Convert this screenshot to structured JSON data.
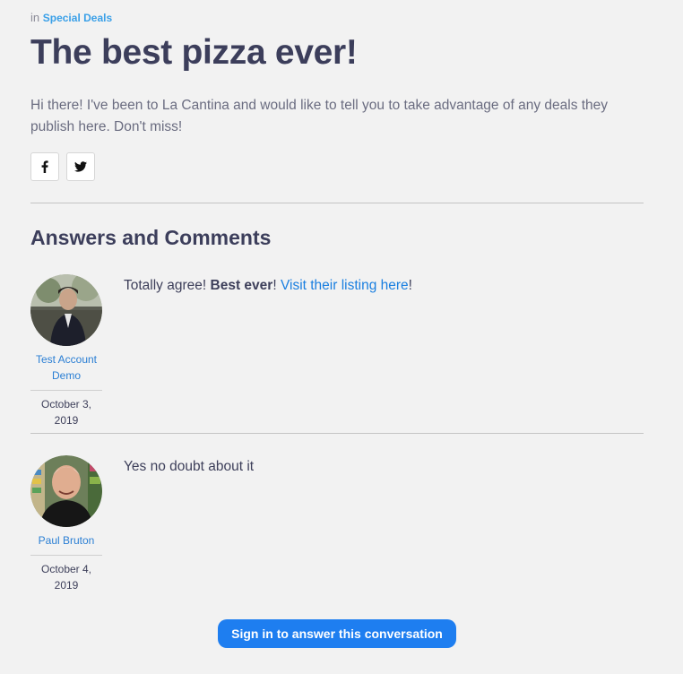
{
  "breadcrumb": {
    "prefix": "in",
    "category": "Special Deals"
  },
  "post": {
    "title": "The best pizza ever!",
    "body": "Hi there! I've been to La Cantina and would like to tell you to take advantage of any deals they publish here. Don't miss!"
  },
  "share": {
    "facebook_icon": "facebook-icon",
    "twitter_icon": "twitter-icon"
  },
  "comments_section": {
    "title": "Answers and Comments",
    "items": [
      {
        "author": "Test Account Demo",
        "date": "October 3, 2019",
        "text_part1": "Totally agree!",
        "text_part2": "Best ever",
        "text_part3": "!",
        "link_text": "Visit their listing here",
        "text_part4": "!"
      },
      {
        "author": "Paul Bruton",
        "date": "October 4, 2019",
        "text": "Yes no doubt about it"
      }
    ]
  },
  "actions": {
    "signin_label": "Sign in to answer this conversation"
  },
  "colors": {
    "accent": "#1e7ef0",
    "link": "#2b7fd4",
    "background": "#f2f2f2",
    "heading": "#3c3e5b"
  }
}
